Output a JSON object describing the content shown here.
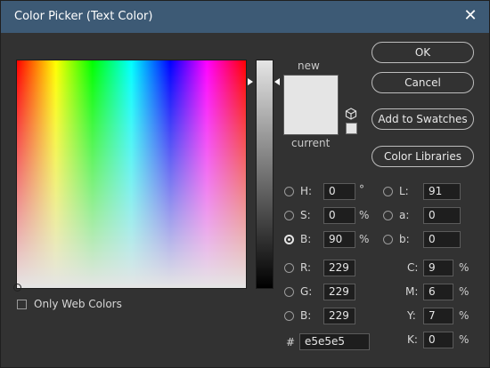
{
  "window": {
    "title": "Color Picker (Text Color)",
    "close_glyph": "✕"
  },
  "preview": {
    "new_label": "new",
    "current_label": "current",
    "color": "#e5e5e5"
  },
  "buttons": {
    "ok": "OK",
    "cancel": "Cancel",
    "add_to_swatches": "Add to Swatches",
    "color_libraries": "Color Libraries"
  },
  "hsb": [
    {
      "label": "H:",
      "value": "0",
      "unit": "°",
      "selected": false
    },
    {
      "label": "S:",
      "value": "0",
      "unit": "%",
      "selected": false
    },
    {
      "label": "B:",
      "value": "90",
      "unit": "%",
      "selected": true
    }
  ],
  "rgb": [
    {
      "label": "R:",
      "value": "229"
    },
    {
      "label": "G:",
      "value": "229"
    },
    {
      "label": "B:",
      "value": "229"
    }
  ],
  "lab": [
    {
      "label": "L:",
      "value": "91"
    },
    {
      "label": "a:",
      "value": "0"
    },
    {
      "label": "b:",
      "value": "0"
    }
  ],
  "cmyk": [
    {
      "label": "C:",
      "value": "9",
      "unit": "%"
    },
    {
      "label": "M:",
      "value": "6",
      "unit": "%"
    },
    {
      "label": "Y:",
      "value": "7",
      "unit": "%"
    },
    {
      "label": "K:",
      "value": "0",
      "unit": "%"
    }
  ],
  "hex": {
    "label": "#",
    "value": "e5e5e5"
  },
  "only_web_colors": {
    "label": "Only Web Colors",
    "checked": false
  },
  "icons": [
    "close-icon",
    "gamut-cube-icon"
  ]
}
